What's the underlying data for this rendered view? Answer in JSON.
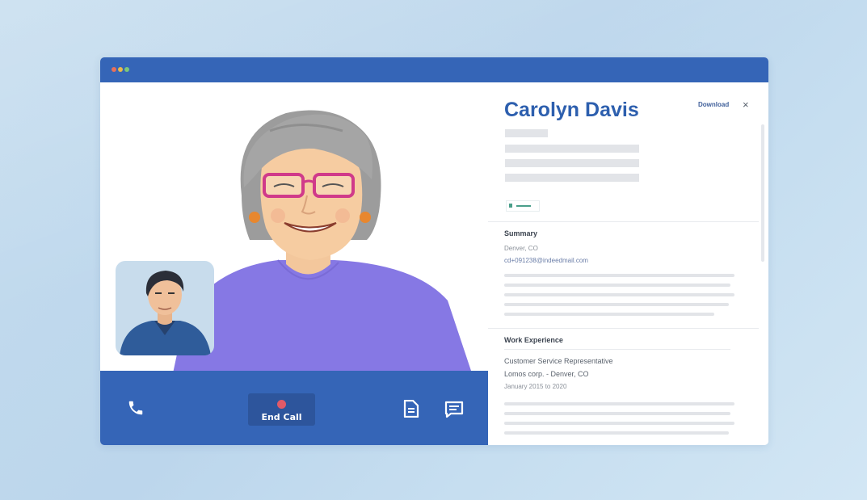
{
  "window": {
    "traffic_lights": [
      "#e8705a",
      "#e9b84a",
      "#7cc77a"
    ],
    "accent": "#3565b7"
  },
  "call": {
    "end_call_label": "End Call",
    "phone_icon": "phone-icon",
    "document_icon": "document-icon",
    "chat_icon": "chat-icon"
  },
  "profile": {
    "name": "Carolyn Davis",
    "download_label": "Download",
    "close_label": "×",
    "summary_title": "Summary",
    "location": "Denver, CO",
    "email": "cd+091238@indeedmail.com",
    "work_title": "Work Experience",
    "job_title": "Customer Service Representative",
    "company": "Lomos corp. - Denver, CO",
    "dates": "January 2015 to 2020"
  }
}
